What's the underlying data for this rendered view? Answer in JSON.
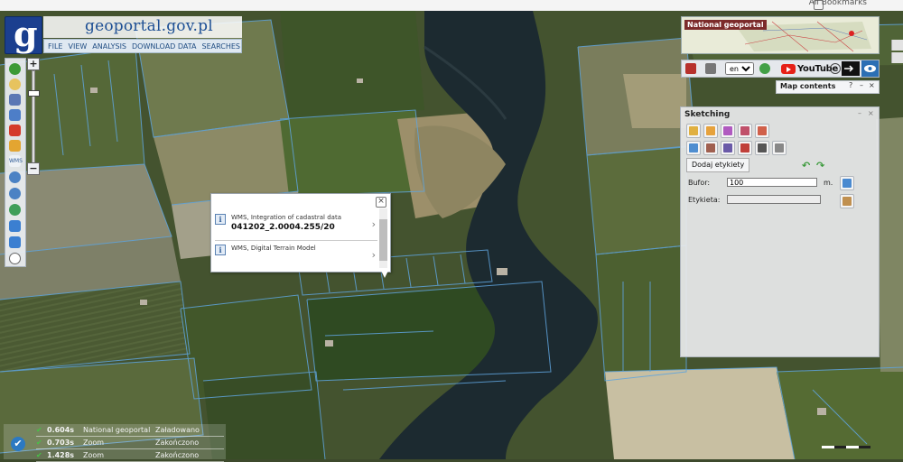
{
  "browser": {
    "bookmarks_label": "All Bookmarks"
  },
  "header": {
    "logo_letter": "g",
    "brand_text": "geoportal.gov.pl",
    "menu": [
      "FILE",
      "VIEW",
      "ANALYSIS",
      "DOWNLOAD DATA",
      "SEARCHES"
    ]
  },
  "left_toolbar": {
    "tools": [
      "info-icon",
      "measure-icon",
      "layers-icon",
      "select-icon",
      "print-icon",
      "pencil-icon",
      "wms-icon",
      "zoom-in-icon",
      "zoom-out-icon",
      "globe-icon",
      "back-arrow-icon",
      "forward-arrow-icon",
      "compass-icon"
    ],
    "wms_label": "WMS",
    "zoom_plus": "+",
    "zoom_minus": "−"
  },
  "popup": {
    "close_label": "×",
    "items": [
      {
        "source": "WMS, Integration of cadastral data",
        "value": "041202_2.0004.255/20",
        "arrow": "›"
      },
      {
        "source": "WMS, Digital Terrain Model",
        "value": "",
        "arrow": "›"
      }
    ]
  },
  "overview": {
    "caption": "National geoportal"
  },
  "right_toolbar": {
    "language": "eng",
    "language_options": [
      "eng"
    ],
    "youtube_label": "YouTube",
    "accent_blue": "#2c6fb4"
  },
  "map_contents": {
    "title": "Map contents",
    "help": "?",
    "min": "–",
    "close": "×"
  },
  "sketching": {
    "title": "Sketching",
    "min": "–",
    "close": "×",
    "add_labels_button": "Dodaj etykiety",
    "buffer_label": "Bufor:",
    "buffer_value": "100",
    "buffer_unit": "m.",
    "label_label": "Etykieta:",
    "label_value": "",
    "undo": "↶",
    "redo": "↷"
  },
  "status": {
    "rows": [
      {
        "check": "✔",
        "time": "0.604s",
        "name": "National geoportal",
        "state": "Załadowano"
      },
      {
        "check": "✔",
        "time": "0.703s",
        "name": "Zoom",
        "state": "Zakończono"
      },
      {
        "check": "✔",
        "time": "1.428s",
        "name": "Zoom",
        "state": "Zakończono"
      }
    ]
  }
}
